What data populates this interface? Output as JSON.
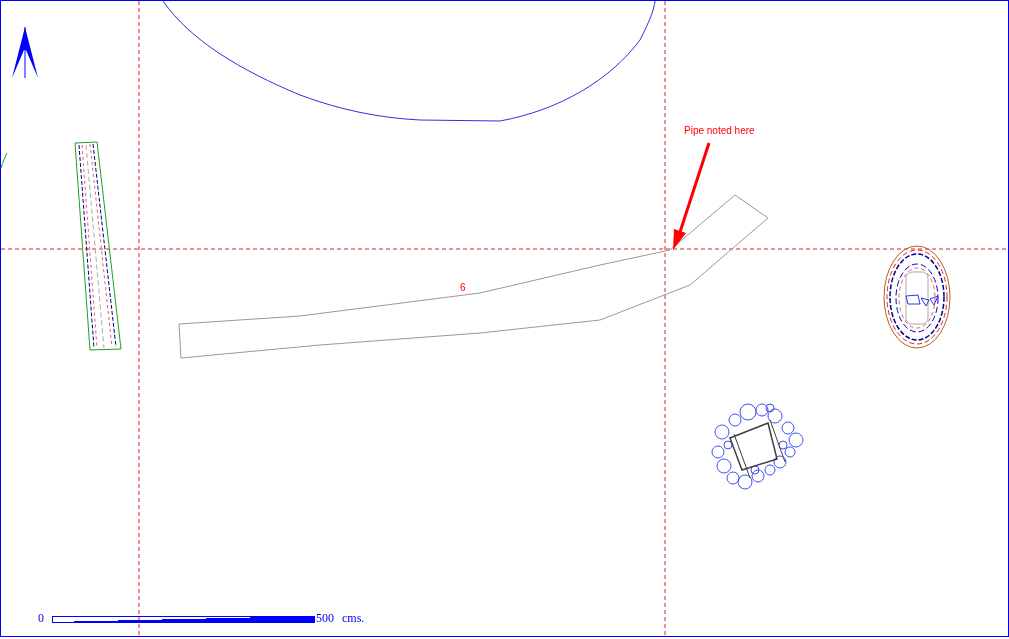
{
  "annotation": {
    "text": "Pipe noted here"
  },
  "feature_label": "6",
  "scale_bar": {
    "start": "0",
    "end": "500",
    "unit": "cms."
  }
}
